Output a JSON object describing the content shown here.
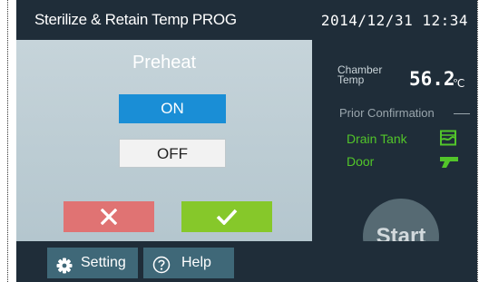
{
  "header": {
    "title": "Sterilize & Retain Temp PROG",
    "datetime": "2014/12/31 12:34"
  },
  "preheat": {
    "heading": "Preheat",
    "on_label": "ON",
    "off_label": "OFF",
    "selected": "ON"
  },
  "status": {
    "chamber_label_line1": "Chamber",
    "chamber_label_line2": "Temp",
    "chamber_value": "56.2",
    "chamber_unit": "℃",
    "prior_confirmation": "Prior Confirmation",
    "drain_tank": "Drain Tank",
    "door": "Door",
    "start_label": "Start"
  },
  "footer": {
    "setting_label": "Setting",
    "help_label": "Help"
  },
  "colors": {
    "title_bg": "#1f2d39",
    "on_selected": "#1a8ed6",
    "cancel": "#e07373",
    "confirm": "#86c82a",
    "ok_green": "#52c52a",
    "footer_button": "#3f6878",
    "start_disabled": "#566a73"
  },
  "icons": [
    "cancel-x-icon",
    "confirm-check-icon",
    "drain-tank-icon",
    "door-icon",
    "gear-icon",
    "help-circle-icon"
  ]
}
